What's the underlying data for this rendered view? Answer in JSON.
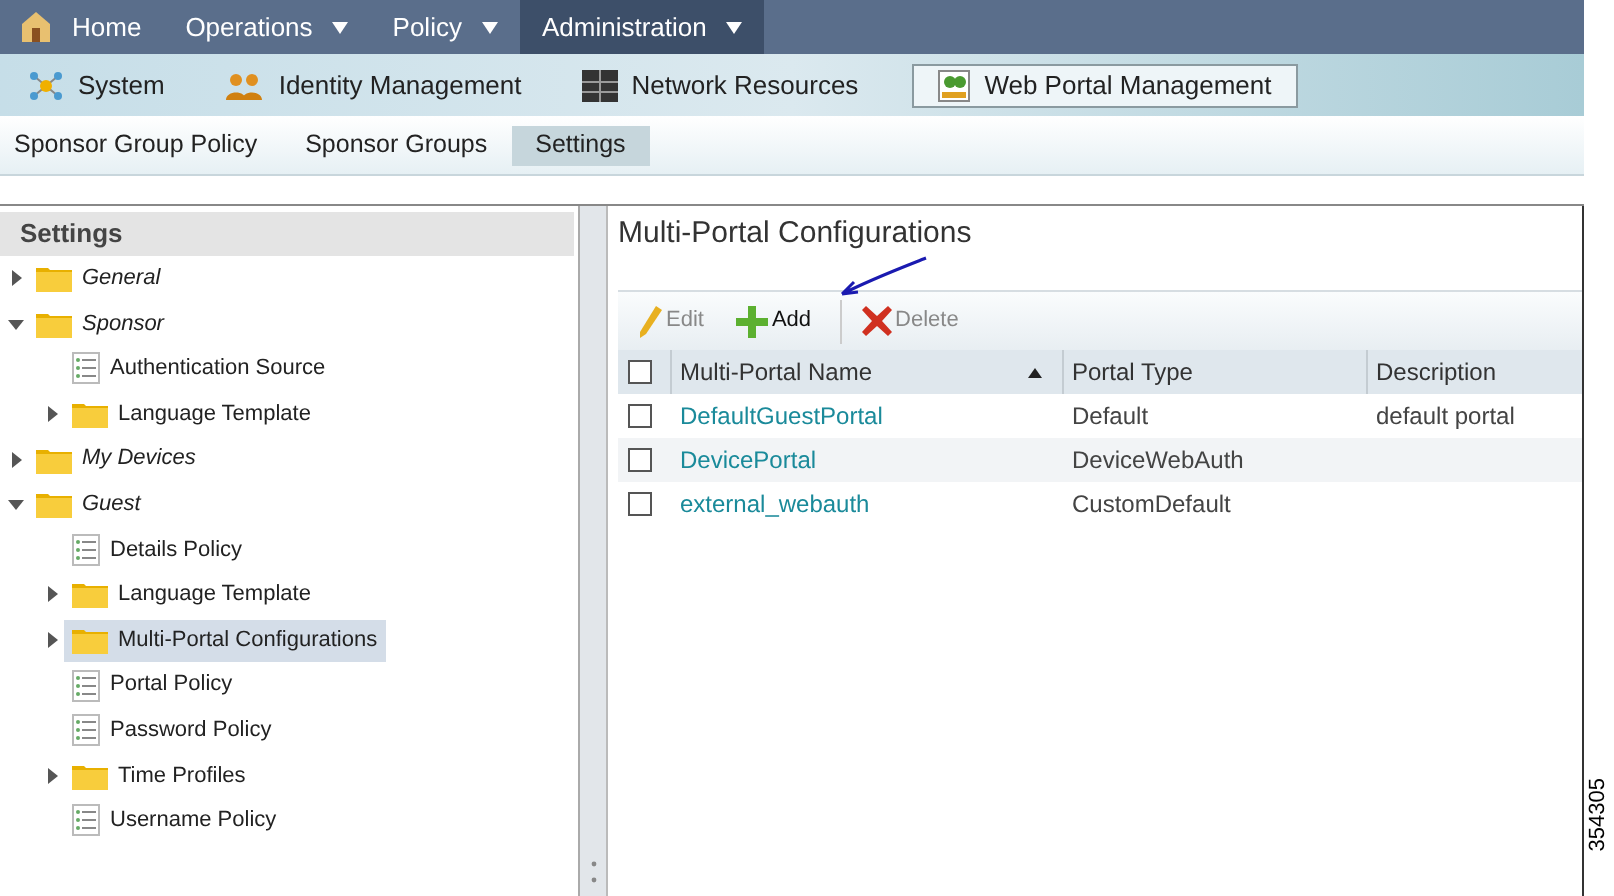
{
  "top_menu": [
    {
      "label": "Home",
      "has_menu": false,
      "selected": false
    },
    {
      "label": "Operations",
      "has_menu": true,
      "selected": false
    },
    {
      "label": "Policy",
      "has_menu": true,
      "selected": false
    },
    {
      "label": "Administration",
      "has_menu": true,
      "selected": true
    }
  ],
  "sub_menu": [
    {
      "label": "System",
      "kind": "network",
      "selected": false
    },
    {
      "label": "Identity Management",
      "kind": "users",
      "selected": false
    },
    {
      "label": "Network Resources",
      "kind": "grid",
      "selected": false
    },
    {
      "label": "Web Portal Management",
      "kind": "portal",
      "selected": true
    }
  ],
  "page_tabs": [
    {
      "label": "Sponsor Group Policy",
      "selected": false
    },
    {
      "label": "Sponsor Groups",
      "selected": false
    },
    {
      "label": "Settings",
      "selected": true
    }
  ],
  "sidebar": {
    "title": "Settings",
    "items": [
      {
        "label": "General",
        "kind": "folder",
        "expanded": false,
        "selected": false
      },
      {
        "label": "Sponsor",
        "kind": "folder",
        "expanded": true,
        "selected": false,
        "children": [
          {
            "label": "Authentication Source",
            "kind": "page",
            "selected": false
          },
          {
            "label": "Language Template",
            "kind": "folder",
            "expanded": false,
            "selected": false
          }
        ]
      },
      {
        "label": "My Devices",
        "kind": "folder",
        "expanded": false,
        "selected": false
      },
      {
        "label": "Guest",
        "kind": "folder",
        "expanded": true,
        "selected": false,
        "children": [
          {
            "label": "Details Policy",
            "kind": "page",
            "selected": false
          },
          {
            "label": "Language Template",
            "kind": "folder",
            "expanded": false,
            "selected": false
          },
          {
            "label": "Multi-Portal Configurations",
            "kind": "folder",
            "expanded": false,
            "selected": true
          },
          {
            "label": "Portal Policy",
            "kind": "page",
            "selected": false
          },
          {
            "label": "Password Policy",
            "kind": "page",
            "selected": false
          },
          {
            "label": "Time Profiles",
            "kind": "folder",
            "expanded": false,
            "selected": false
          },
          {
            "label": "Username Policy",
            "kind": "page",
            "selected": false
          }
        ]
      }
    ]
  },
  "content": {
    "title": "Multi-Portal Configurations",
    "toolbar": [
      {
        "label": "Edit",
        "kind": "edit",
        "disabled": true
      },
      {
        "label": "Add",
        "kind": "add",
        "disabled": false
      },
      {
        "label": "Delete",
        "kind": "delete",
        "disabled": true
      }
    ],
    "table": {
      "all_checked": false,
      "columns": [
        {
          "label": "Multi-Portal Name",
          "sorted": true
        },
        {
          "label": "Portal Type",
          "sorted": false
        },
        {
          "label": "Description",
          "sorted": false
        }
      ],
      "rows": [
        {
          "checked": false,
          "cells": [
            "DefaultGuestPortal",
            "Default",
            "default portal"
          ]
        },
        {
          "checked": false,
          "cells": [
            "DevicePortal",
            "DeviceWebAuth",
            ""
          ]
        },
        {
          "checked": false,
          "cells": [
            "external_webauth",
            "CustomDefault",
            ""
          ]
        }
      ]
    }
  },
  "figure_number": "354305"
}
